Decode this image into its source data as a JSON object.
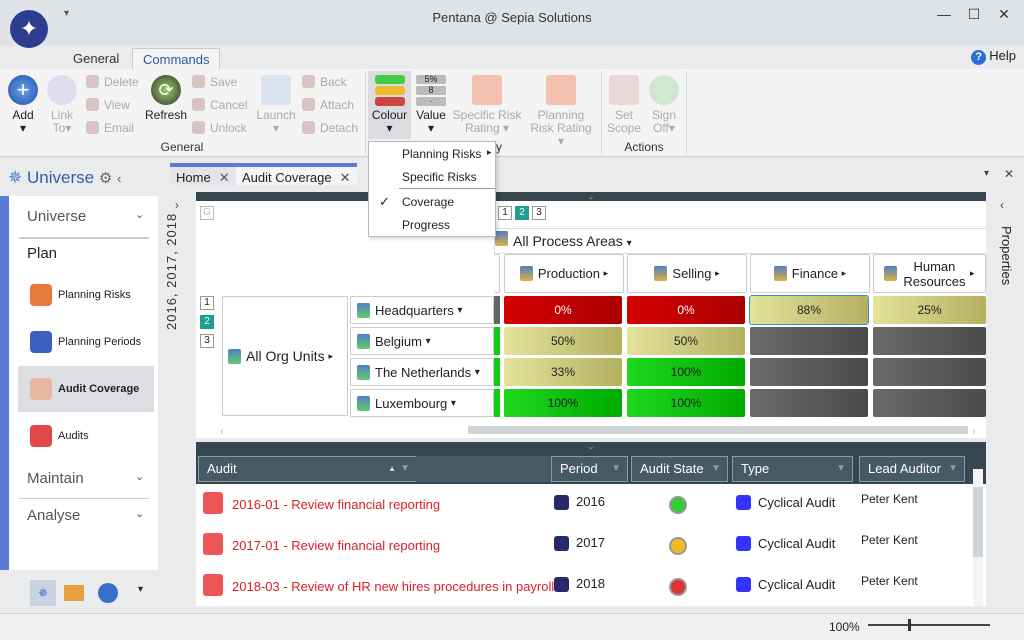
{
  "window": {
    "title": "Pentana @ Sepia Solutions"
  },
  "ribbon": {
    "tabs": [
      {
        "label": "General"
      },
      {
        "label": "Commands"
      }
    ],
    "help": "Help",
    "general": {
      "label": "General",
      "add": "Add",
      "link_to": "Link To",
      "delete": "Delete",
      "view": "View",
      "email": "Email",
      "refresh": "Refresh",
      "save": "Save",
      "cancel": "Cancel",
      "unlock": "Unlock",
      "launch": "Launch",
      "back": "Back",
      "attach": "Attach",
      "detach": "Detach"
    },
    "display": {
      "colour": "Colour",
      "value": "Value",
      "value_icon_text": [
        "5%",
        "8",
        "·"
      ],
      "specific_risk_rating": "Specific Risk Rating",
      "planning_risk_rating": "Planning Risk Rating",
      "label_fragment": "y"
    },
    "actions": {
      "label": "Actions",
      "set_scope": "Set Scope",
      "sign_off": "Sign Off"
    }
  },
  "colour_menu": {
    "items": [
      {
        "label": "Planning Risks",
        "submenu": true
      },
      {
        "label": "Specific Risks"
      },
      {
        "label": "Coverage",
        "checked": true
      },
      {
        "label": "Progress"
      }
    ]
  },
  "sidebar": {
    "title": "Universe",
    "sections": [
      {
        "label": "Universe"
      },
      {
        "label": "Plan"
      },
      {
        "label": "Maintain"
      },
      {
        "label": "Analyse"
      }
    ],
    "items": [
      {
        "label": "Planning Risks"
      },
      {
        "label": "Planning Periods"
      },
      {
        "label": "Audit Coverage",
        "selected": true
      },
      {
        "label": "Audits"
      }
    ]
  },
  "doc_tabs": [
    {
      "label": "Home"
    },
    {
      "label": "Audit Coverage",
      "active": true
    }
  ],
  "filter_years": "2016, 2017, 2018",
  "pivot": {
    "levels": [
      "1",
      "2",
      "3"
    ],
    "active_level": "2",
    "process_root": "All Process Areas",
    "columns": [
      "Production",
      "Selling",
      "Finance",
      "Human Resources"
    ],
    "org_root": "All Org Units",
    "rows": [
      {
        "label": "Headquarters",
        "values": [
          "0%",
          "0%",
          "88%",
          "25%"
        ]
      },
      {
        "label": "Belgium",
        "values": [
          "50%",
          "50%",
          "",
          ""
        ]
      },
      {
        "label": "The Netherlands",
        "values": [
          "33%",
          "100%",
          "",
          ""
        ]
      },
      {
        "label": "Luxembourg",
        "values": [
          "100%",
          "100%",
          "",
          ""
        ]
      }
    ],
    "colors": {
      "red": "#d40000",
      "yellow": "#d8d67a",
      "green": "#1fd81f",
      "grey": "#5a5a5a"
    }
  },
  "audits": {
    "columns": [
      "Audit",
      "Period",
      "Audit State",
      "Type",
      "Lead Auditor"
    ],
    "rows": [
      {
        "audit": "2016-01 - Review financial reporting",
        "period": "2016",
        "state": "green",
        "type": "Cyclical Audit",
        "lead": "Peter Kent"
      },
      {
        "audit": "2017-01 - Review financial reporting",
        "period": "2017",
        "state": "yellow",
        "type": "Cyclical Audit",
        "lead": "Peter Kent"
      },
      {
        "audit": "2018-03 - Review of HR new hires procedures in payroll",
        "period": "2018",
        "state": "red",
        "type": "Cyclical Audit",
        "lead": "Peter Kent"
      }
    ]
  },
  "properties_label": "Properties",
  "status": {
    "zoom": "100%",
    "zoom_value": 100
  }
}
